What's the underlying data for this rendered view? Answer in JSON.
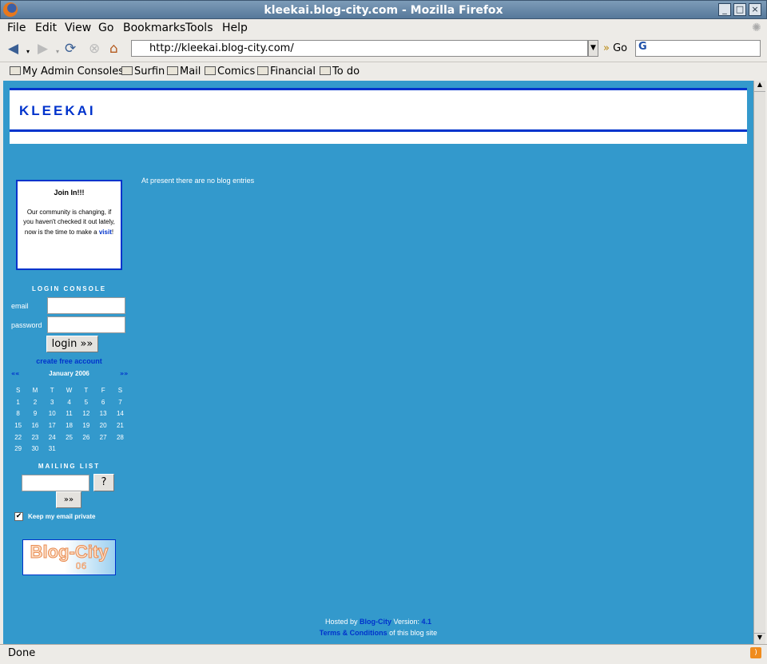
{
  "window": {
    "title": "kleekai.blog-city.com - Mozilla Firefox"
  },
  "menu": [
    "File",
    "Edit",
    "View",
    "Go",
    "Bookmarks",
    "Tools",
    "Help"
  ],
  "nav": {
    "url": "http://kleekai.blog-city.com/",
    "go_label": "Go",
    "search_placeholder": ""
  },
  "bookmarks": [
    "My Admin Consoles",
    "Surfin",
    "Mail",
    "Comics",
    "Financial",
    "To do"
  ],
  "page": {
    "blog_title": "KLEEKAI",
    "no_entries": "At present there are no blog entries",
    "join": {
      "title": "Join In!!!",
      "text": "Our community is changing, if you haven't checked it out lately, now is the time to make a ",
      "link": "visit",
      "after": "!"
    },
    "login": {
      "heading": "LOGIN CONSOLE",
      "email_label": "email",
      "password_label": "password",
      "email_value": "",
      "password_value": "",
      "button": "login »»",
      "create": "create free account"
    },
    "calendar": {
      "prev": "««",
      "next": "»»",
      "month": "January 2006",
      "days": [
        "S",
        "M",
        "T",
        "W",
        "T",
        "F",
        "S"
      ],
      "weeks": [
        [
          "1",
          "2",
          "3",
          "4",
          "5",
          "6",
          "7"
        ],
        [
          "8",
          "9",
          "10",
          "11",
          "12",
          "13",
          "14"
        ],
        [
          "15",
          "16",
          "17",
          "18",
          "19",
          "20",
          "21"
        ],
        [
          "22",
          "23",
          "24",
          "25",
          "26",
          "27",
          "28"
        ],
        [
          "29",
          "30",
          "31",
          "",
          "",
          "",
          ""
        ]
      ]
    },
    "mailing": {
      "heading": "MAILING LIST",
      "value": "",
      "help": "?",
      "submit": "»»",
      "private_label": "Keep my email private",
      "private_checked": true
    },
    "badge": {
      "text": "Blog-City",
      "sub": "06"
    },
    "footer": {
      "hosted": "Hosted by ",
      "host_link": "Blog-City",
      "version_label": " Version: ",
      "version": "4.1",
      "terms": "Terms & Conditions",
      "terms_after": " of this blog site"
    }
  },
  "status": {
    "text": "Done"
  },
  "colors": {
    "page_bg": "#3399cc",
    "accent": "#0033cc"
  }
}
